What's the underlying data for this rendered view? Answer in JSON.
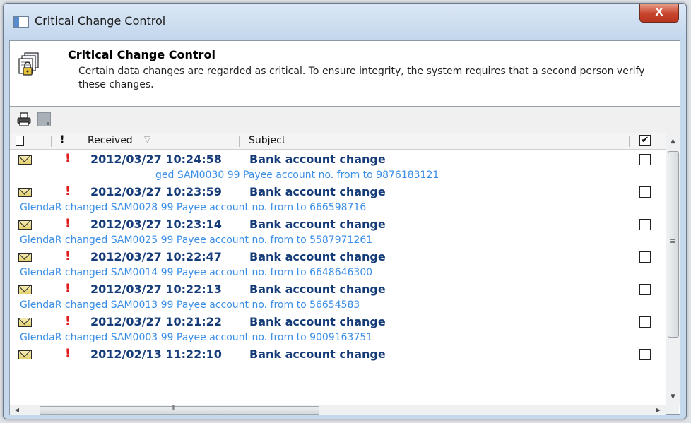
{
  "window": {
    "title": "Critical Change Control",
    "close_label": "X"
  },
  "header": {
    "title": "Critical Change Control",
    "description": "Certain data changes are regarded as critical. To ensure integrity, the system requires that a second person verify these changes."
  },
  "toolbar": {
    "items": [
      "print-icon",
      "select-icon"
    ]
  },
  "columns": {
    "type_icon": "document-icon",
    "priority": "!",
    "received": "Received",
    "sort_indicator": "▽",
    "subject": "Subject",
    "select_all": "✔"
  },
  "rows": [
    {
      "received": "2012/03/27 10:24:58",
      "subject": "Bank account change",
      "detail": "ged SAM0030  99 Payee account no. from  to 9876183121",
      "checked": false
    },
    {
      "received": "2012/03/27 10:23:59",
      "subject": "Bank account change",
      "detail": "GlendaR changed SAM0028  99 Payee account no. from  to 666598716",
      "checked": false
    },
    {
      "received": "2012/03/27 10:23:14",
      "subject": "Bank account change",
      "detail": "GlendaR changed SAM0025  99 Payee account no. from  to 5587971261",
      "checked": false
    },
    {
      "received": "2012/03/27 10:22:47",
      "subject": "Bank account change",
      "detail": "GlendaR changed SAM0014  99 Payee account no. from  to 6648646300",
      "checked": false
    },
    {
      "received": "2012/03/27 10:22:13",
      "subject": "Bank account change",
      "detail": "GlendaR changed SAM0013  99 Payee account no. from  to 56654583",
      "checked": false
    },
    {
      "received": "2012/03/27 10:21:22",
      "subject": "Bank account change",
      "detail": "GlendaR changed SAM0003  99 Payee account no. from  to 9009163751",
      "checked": false
    },
    {
      "received": "2012/02/13 11:22:10",
      "subject": "Bank account change",
      "detail": "",
      "checked": false
    }
  ],
  "colors": {
    "row_text": "#153c78",
    "detail_text": "#3a8ee6",
    "priority": "#e11c1c"
  }
}
